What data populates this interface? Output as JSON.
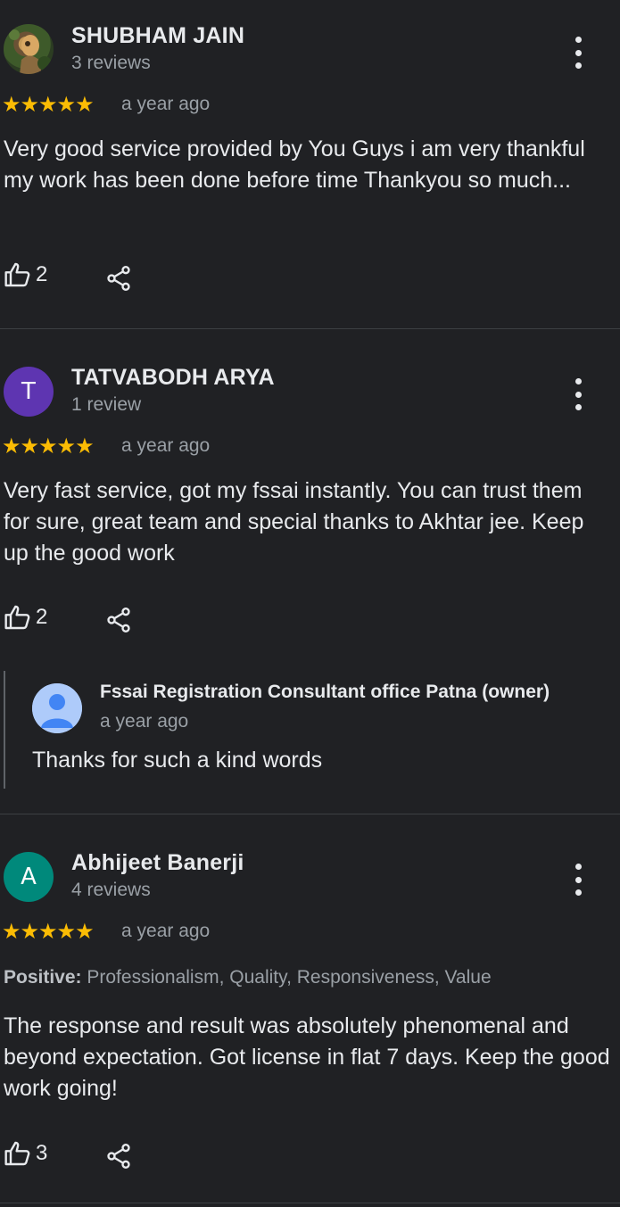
{
  "reviews": [
    {
      "name": "SHUBHAM JAIN",
      "count": "3 reviews",
      "stars": "★★★★★",
      "rating": 5,
      "time": "a year ago",
      "text": "Very good service provided by You Guys i am very thankful my work has been done before time Thankyou so much...",
      "likes": "2"
    },
    {
      "initial": "T",
      "avatar_color": "#5e35b1",
      "name": "TATVABODH ARYA",
      "count": "1 review",
      "stars": "★★★★★",
      "rating": 5,
      "time": "a year ago",
      "text": "Very fast service, got my fssai instantly. You can trust them for sure, great team and special thanks to Akhtar jee. Keep up the good work",
      "likes": "2",
      "reply": {
        "name": "Fssai Registration Consultant office Patna (owner)",
        "time": "a year ago",
        "text": "Thanks for such a kind words"
      }
    },
    {
      "initial": "A",
      "avatar_color": "#00897b",
      "name": "Abhijeet Banerji",
      "count": "4 reviews",
      "stars": "★★★★★",
      "rating": 5,
      "time": "a year ago",
      "positive_label": "Positive:",
      "positive_values": "Professionalism, Quality, Responsiveness, Value",
      "text": "The response and result was absolutely phenomenal and beyond expectation. Got license in flat 7 days. Keep the good work going!",
      "likes": "3"
    }
  ],
  "icons": {
    "more": "more-vert-icon",
    "like": "thumb-up-icon",
    "share": "share-icon",
    "reply_avatar": "default-user-icon"
  },
  "colors": {
    "background": "#202124",
    "star": "#fbbc04",
    "secondary_text": "#9aa0a6"
  }
}
